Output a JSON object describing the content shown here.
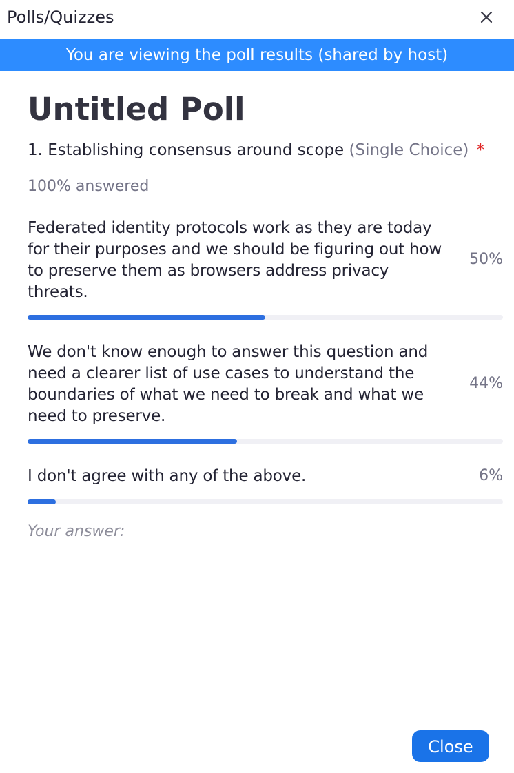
{
  "window": {
    "title": "Polls/Quizzes",
    "close_icon": "close-icon"
  },
  "banner": {
    "text": "You are viewing the poll results (shared by host)",
    "color": "#2d8cff"
  },
  "poll": {
    "title": "Untitled Poll",
    "question": {
      "text": "1. Establishing consensus around scope",
      "type": "(Single Choice)",
      "required_mark": "*"
    },
    "answered": "100% answered",
    "options": [
      {
        "text": "Federated identity protocols work as they are today for their purposes and we should be figuring out how to preserve them as browsers address privacy threats.",
        "percent_label": "50%",
        "fraction": 0.5
      },
      {
        "text": "We don't know enough to answer this question and need a clearer list of use cases to understand the boundaries of what we need to break and what we need to preserve.",
        "percent_label": "44%",
        "fraction": 0.44
      },
      {
        "text": "I don't agree with any of the above.",
        "percent_label": "6%",
        "fraction": 0.06
      }
    ],
    "your_answer_label": "Your answer:",
    "bar_color": "#2d6fe0"
  },
  "footer": {
    "close_label": "Close"
  }
}
